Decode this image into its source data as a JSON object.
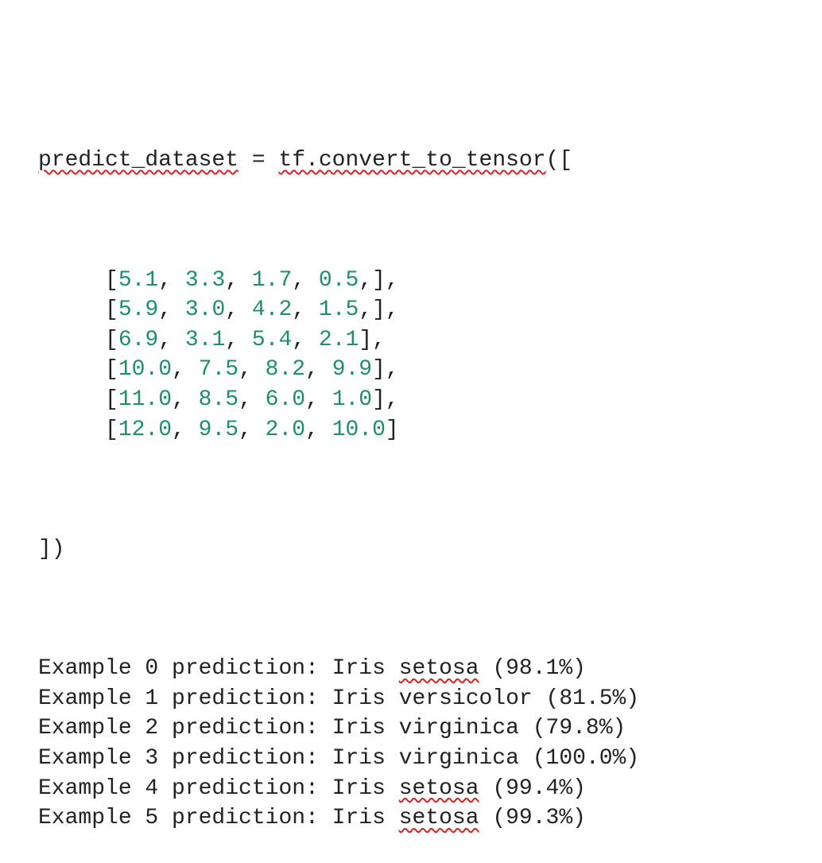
{
  "code": {
    "assign": {
      "var_name": "predict_dataset",
      "equals": " = ",
      "func_name": "tf.convert_to_tensor",
      "open": "(["
    },
    "rows": [
      [
        "5.1",
        "3.3",
        "1.7",
        "0.5"
      ],
      [
        "5.9",
        "3.0",
        "4.2",
        "1.5"
      ],
      [
        "6.9",
        "3.1",
        "5.4",
        "2.1"
      ],
      [
        "10.0",
        "7.5",
        "8.2",
        "9.9"
      ],
      [
        "11.0",
        "8.5",
        "6.0",
        "1.0"
      ],
      [
        "12.0",
        "9.5",
        "2.0",
        "10.0"
      ]
    ],
    "row_endings": [
      ",],",
      ",],",
      "],",
      "],",
      "],",
      "]"
    ],
    "close": "])"
  },
  "output": [
    {
      "prefix": "Example 0 prediction: Iris ",
      "species": "setosa",
      "flag": true,
      "suffix": " (98.1%)"
    },
    {
      "prefix": "Example 1 prediction: Iris ",
      "species": "versicolor",
      "flag": false,
      "suffix": " (81.5%)"
    },
    {
      "prefix": "Example 2 prediction: Iris ",
      "species": "virginica",
      "flag": false,
      "suffix": " (79.8%)"
    },
    {
      "prefix": "Example 3 prediction: Iris ",
      "species": "virginica",
      "flag": false,
      "suffix": " (100.0%)"
    },
    {
      "prefix": "Example 4 prediction: Iris ",
      "species": "setosa",
      "flag": true,
      "suffix": " (99.4%)"
    },
    {
      "prefix": "Example 5 prediction: Iris ",
      "species": "setosa",
      "flag": true,
      "suffix": " (99.3%)"
    }
  ],
  "colors": {
    "text": "#222222",
    "number": "#1f8f6b",
    "spellcheck": "#e02020"
  }
}
